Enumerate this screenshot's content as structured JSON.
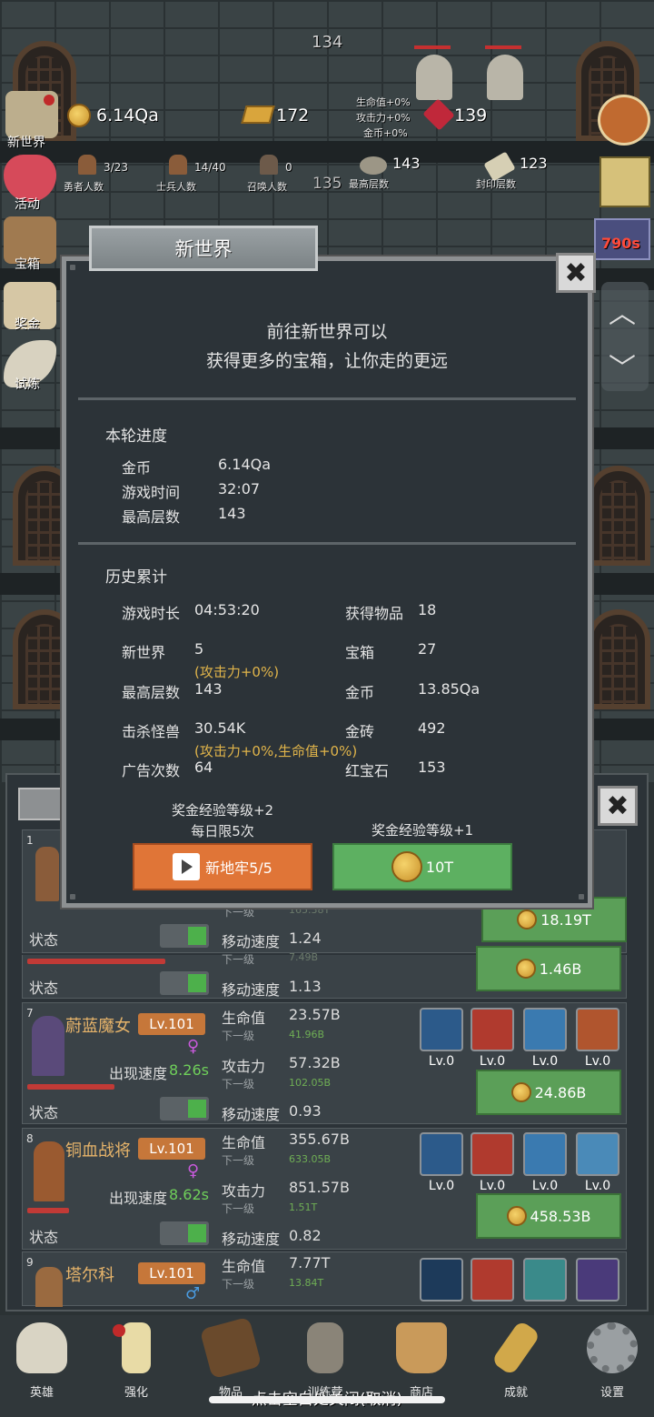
{
  "top": {
    "floor_number": "134",
    "gold": "6.14Qa",
    "gold_bars": "172",
    "bonus_lines": [
      "生命值+0%",
      "攻击力+0%",
      "金币+0%"
    ],
    "rubies": "139",
    "heroes": {
      "value": "3/23",
      "label": "勇者人数"
    },
    "soldiers": {
      "value": "14/40",
      "label": "士兵人数"
    },
    "summons": {
      "value": "0",
      "label": "召唤人数"
    },
    "floor_left": "135",
    "max_floor": {
      "value": "143",
      "label": "最高层数"
    },
    "sealed": {
      "value": "123",
      "label": "封印层数"
    },
    "timer": "790s"
  },
  "side_menu": [
    "新世界",
    "活动",
    "宝箱",
    "奖金",
    "试炼"
  ],
  "modal": {
    "title": "新世界",
    "close_symbol": "✖",
    "desc_line1": "前往新世界可以",
    "desc_line2": "获得更多的宝箱，让你走的更远",
    "round_heading": "本轮进度",
    "round_rows": [
      {
        "label": "金币",
        "value": "6.14Qa"
      },
      {
        "label": "游戏时间",
        "value": "32:07"
      },
      {
        "label": "最高层数",
        "value": "143"
      }
    ],
    "history_heading": "历史累计",
    "history": {
      "play_time": {
        "label": "游戏时长",
        "value": "04:53:20"
      },
      "items": {
        "label": "获得物品",
        "value": "18"
      },
      "new_world": {
        "label": "新世界",
        "value": "5"
      },
      "chests": {
        "label": "宝箱",
        "value": "27"
      },
      "bonus1": "(攻击力+0%)",
      "max_floor": {
        "label": "最高层数",
        "value": "143"
      },
      "gold": {
        "label": "金币",
        "value": "13.85Qa"
      },
      "kills": {
        "label": "击杀怪兽",
        "value": "30.54K"
      },
      "gold_bricks": {
        "label": "金砖",
        "value": "492"
      },
      "bonus2": "(攻击力+0%,生命值+0%)",
      "ads": {
        "label": "广告次数",
        "value": "64"
      },
      "rubies": {
        "label": "红宝石",
        "value": "153"
      }
    },
    "left_reward_line1": "奖金经验等级+2",
    "left_reward_line2": "每日限5次",
    "right_reward": "奖金经验等级+1",
    "left_button": "新地牢5/5",
    "right_button": "10T"
  },
  "panel": {
    "close_symbol": "✖",
    "card1": {
      "index": "1",
      "status": "状态",
      "speed_label": "移动速度",
      "speed": "1.24",
      "next_label": "下一级",
      "next_value": "165.38T",
      "price": "18.19T"
    },
    "card2": {
      "status": "状态",
      "speed_label": "移动速度",
      "speed": "1.13",
      "next_label": "下一级",
      "next_value": "7.49B",
      "price": "1.46B"
    },
    "card3": {
      "index": "7",
      "name": "蔚蓝魔女",
      "level": "Lv.101",
      "gender": "♀",
      "appear_label": "出现速度",
      "appear": "8.26s",
      "hp_label": "生命值",
      "hp": "23.57B",
      "hp_next_label": "下一级",
      "hp_next": "41.96B",
      "atk_label": "攻击力",
      "atk": "57.32B",
      "atk_next_label": "下一级",
      "atk_next": "102.05B",
      "status": "状态",
      "speed_label": "移动速度",
      "speed": "0.93",
      "price": "24.86B",
      "skills": [
        "Lv.0",
        "Lv.0",
        "Lv.0",
        "Lv.0"
      ]
    },
    "card4": {
      "index": "8",
      "name": "铜血战将",
      "level": "Lv.101",
      "gender": "♀",
      "appear_label": "出现速度",
      "appear": "8.62s",
      "hp_label": "生命值",
      "hp": "355.67B",
      "hp_next_label": "下一级",
      "hp_next": "633.05B",
      "atk_label": "攻击力",
      "atk": "851.57B",
      "atk_next_label": "下一级",
      "atk_next": "1.51T",
      "status": "状态",
      "speed_label": "移动速度",
      "speed": "0.82",
      "price": "458.53B",
      "skills": [
        "Lv.0",
        "Lv.0",
        "Lv.0",
        "Lv.0"
      ]
    },
    "card5": {
      "index": "9",
      "name": "塔尔科",
      "level": "Lv.101",
      "gender": "♂",
      "hp_label": "生命值",
      "hp": "7.77T",
      "hp_next_label": "下一级",
      "hp_next": "13.84T"
    }
  },
  "nav": [
    "英雄",
    "强化",
    "物品",
    "训练营",
    "商店",
    "成就",
    "设置"
  ],
  "footer_hint": "点击空白处关闭(取消)",
  "colors": {
    "accent_orange": "#e07537",
    "accent_green": "#5db061",
    "gold_text": "#e7b46a"
  }
}
